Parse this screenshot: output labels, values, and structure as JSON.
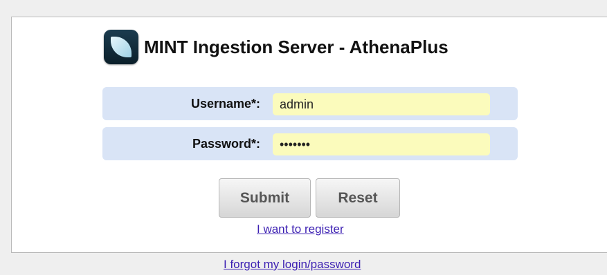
{
  "app": {
    "title": "MINT Ingestion Server - AthenaPlus",
    "logo_icon": "mint-leaf-logo-icon"
  },
  "form": {
    "username_label": "Username*:",
    "username_value": "admin",
    "password_label": "Password*:",
    "password_value": "•••••••"
  },
  "buttons": {
    "submit_label": "Submit",
    "reset_label": "Reset"
  },
  "links": {
    "register": "I want to register",
    "forgot": "I forgot my login/password"
  },
  "colors": {
    "field_row_bg": "#d9e4f6",
    "input_bg": "#fbfbbc",
    "link": "#3b1fb2"
  }
}
